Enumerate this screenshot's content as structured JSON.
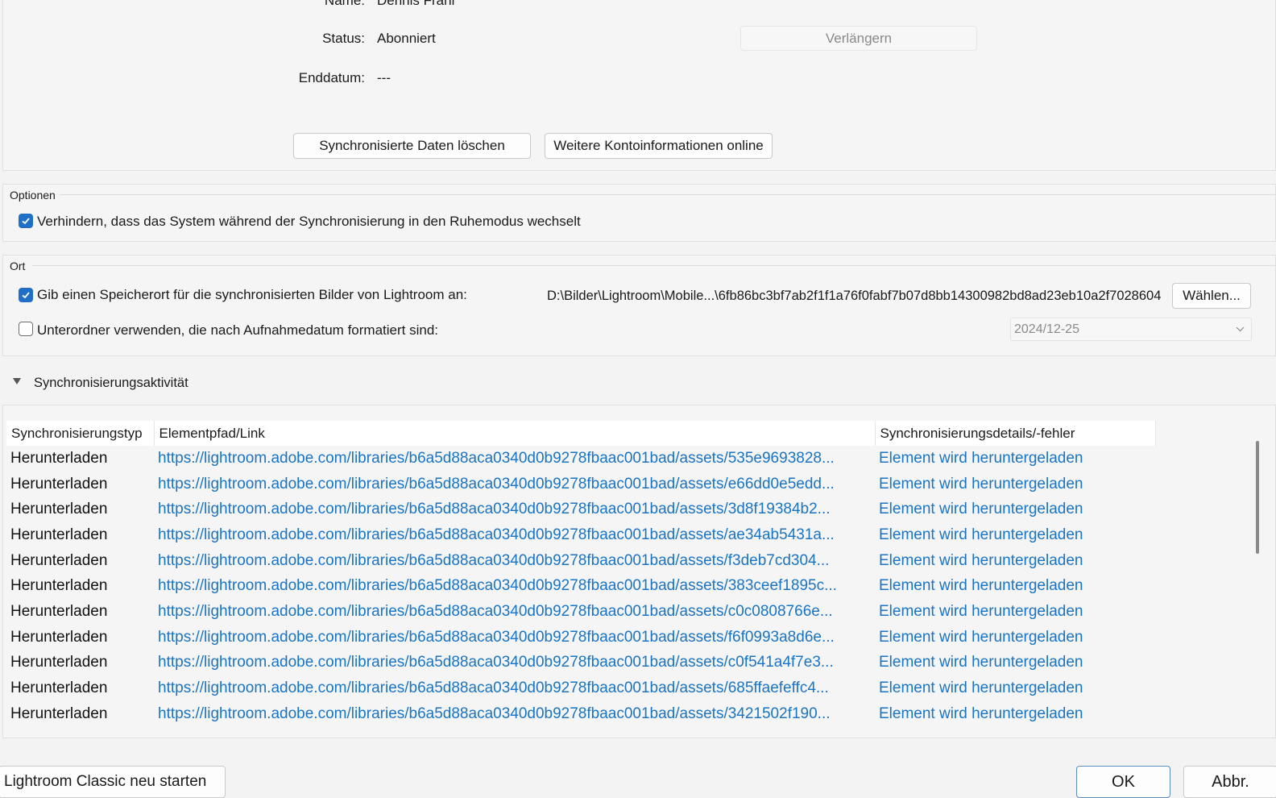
{
  "account": {
    "name_label": "Name:",
    "name_value": "Dennis Frahl",
    "status_label": "Status:",
    "status_value": "Abonniert",
    "enddate_label": "Enddatum:",
    "enddate_value": "---",
    "renew_button": "Verlängern",
    "delete_button": "Synchronisierte Daten löschen",
    "more_info_button": "Weitere Kontoinformationen online"
  },
  "options": {
    "title": "Optionen",
    "prevent_sleep_label": "Verhindern, dass das System während der Synchronisierung in den Ruhemodus wechselt",
    "prevent_sleep_checked": true
  },
  "location": {
    "title": "Ort",
    "specify_label": "Gib einen Speicherort für die synchronisierten Bilder von Lightroom an:",
    "specify_checked": true,
    "path": "D:\\Bilder\\Lightroom\\Mobile...\\6fb86bc3bf7ab2f1f1a76f0fabf7b07d8bb14300982bd8ad23eb10a2f7028604",
    "choose_button": "Wählen...",
    "subfolder_label": "Unterordner verwenden, die nach Aufnahmedatum formatiert sind:",
    "subfolder_checked": false,
    "date_format": "2024/12-25"
  },
  "activity": {
    "title": "Synchronisierungsaktivität",
    "columns": [
      "Synchronisierungstyp",
      "Elementpfad/Link",
      "Synchronisierungsdetails/-fehler"
    ],
    "rows": [
      {
        "type": "Herunterladen",
        "link": "https://lightroom.adobe.com/libraries/b6a5d88aca0340d0b9278fbaac001bad/assets/535e9693828...",
        "detail": "Element wird heruntergeladen"
      },
      {
        "type": "Herunterladen",
        "link": "https://lightroom.adobe.com/libraries/b6a5d88aca0340d0b9278fbaac001bad/assets/e66dd0e5edd...",
        "detail": "Element wird heruntergeladen"
      },
      {
        "type": "Herunterladen",
        "link": "https://lightroom.adobe.com/libraries/b6a5d88aca0340d0b9278fbaac001bad/assets/3d8f19384b2...",
        "detail": "Element wird heruntergeladen"
      },
      {
        "type": "Herunterladen",
        "link": "https://lightroom.adobe.com/libraries/b6a5d88aca0340d0b9278fbaac001bad/assets/ae34ab5431a...",
        "detail": "Element wird heruntergeladen"
      },
      {
        "type": "Herunterladen",
        "link": "https://lightroom.adobe.com/libraries/b6a5d88aca0340d0b9278fbaac001bad/assets/f3deb7cd304...",
        "detail": "Element wird heruntergeladen"
      },
      {
        "type": "Herunterladen",
        "link": "https://lightroom.adobe.com/libraries/b6a5d88aca0340d0b9278fbaac001bad/assets/383ceef1895c...",
        "detail": "Element wird heruntergeladen"
      },
      {
        "type": "Herunterladen",
        "link": "https://lightroom.adobe.com/libraries/b6a5d88aca0340d0b9278fbaac001bad/assets/c0c0808766e...",
        "detail": "Element wird heruntergeladen"
      },
      {
        "type": "Herunterladen",
        "link": "https://lightroom.adobe.com/libraries/b6a5d88aca0340d0b9278fbaac001bad/assets/f6f0993a8d6e...",
        "detail": "Element wird heruntergeladen"
      },
      {
        "type": "Herunterladen",
        "link": "https://lightroom.adobe.com/libraries/b6a5d88aca0340d0b9278fbaac001bad/assets/c0f541a4f7e3...",
        "detail": "Element wird heruntergeladen"
      },
      {
        "type": "Herunterladen",
        "link": "https://lightroom.adobe.com/libraries/b6a5d88aca0340d0b9278fbaac001bad/assets/685ffaefeffc4...",
        "detail": "Element wird heruntergeladen"
      },
      {
        "type": "Herunterladen",
        "link": "https://lightroom.adobe.com/libraries/b6a5d88aca0340d0b9278fbaac001bad/assets/3421502f190...",
        "detail": "Element wird heruntergeladen"
      }
    ]
  },
  "footer": {
    "restart_button": "Lightroom Classic neu starten",
    "ok_button": "OK",
    "cancel_button": "Abbr."
  },
  "colors": {
    "accent": "#1f6fc6",
    "link": "#1a74c4"
  }
}
